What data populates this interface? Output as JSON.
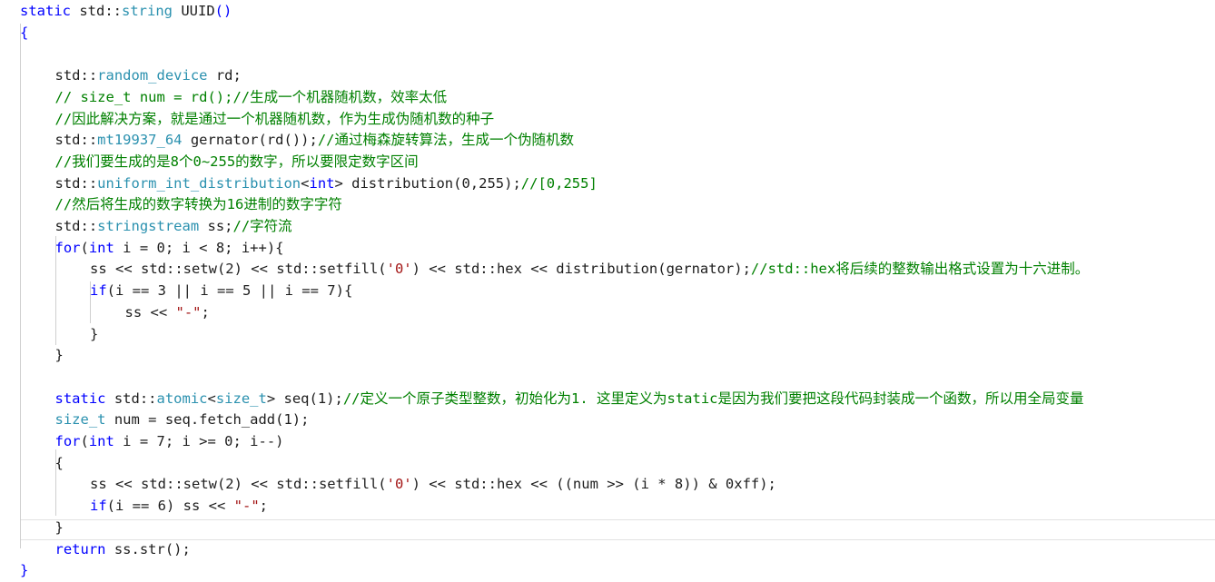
{
  "editor": {
    "accent_colors": {
      "keyword": "#0000ff",
      "type": "#2b91af",
      "comment": "#008000",
      "string": "#a31515",
      "text": "#1e1e1e"
    },
    "lines": [
      {
        "indent": 0,
        "tokens": [
          [
            "kw",
            "static"
          ],
          [
            "nm",
            " std::"
          ],
          [
            "ty",
            "string"
          ],
          [
            "nm",
            " UUID"
          ],
          [
            "kw",
            "()"
          ]
        ]
      },
      {
        "indent": 0,
        "tokens": [
          [
            "kw",
            "{"
          ]
        ]
      },
      {
        "indent": 0,
        "tokens": []
      },
      {
        "indent": 1,
        "tokens": [
          [
            "nm",
            "std::"
          ],
          [
            "ty",
            "random_device"
          ],
          [
            "nm",
            " rd;"
          ]
        ]
      },
      {
        "indent": 1,
        "tokens": [
          [
            "cm",
            "// size_t num = rd();//生成一个机器随机数，效率太低"
          ]
        ]
      },
      {
        "indent": 1,
        "tokens": [
          [
            "cm",
            "//因此解决方案，就是通过一个机器随机数，作为生成伪随机数的种子"
          ]
        ]
      },
      {
        "indent": 1,
        "tokens": [
          [
            "nm",
            "std::"
          ],
          [
            "ty",
            "mt19937_64"
          ],
          [
            "nm",
            " gernator(rd());"
          ],
          [
            "cm",
            "//通过梅森旋转算法，生成一个伪随机数"
          ]
        ]
      },
      {
        "indent": 1,
        "tokens": [
          [
            "cm",
            "//我们要生成的是8个0~255的数字，所以要限定数字区间"
          ]
        ]
      },
      {
        "indent": 1,
        "tokens": [
          [
            "nm",
            "std::"
          ],
          [
            "ty",
            "uniform_int_distribution"
          ],
          [
            "nm",
            "<"
          ],
          [
            "kw",
            "int"
          ],
          [
            "nm",
            "> distribution(0,255);"
          ],
          [
            "cm",
            "//[0,255]"
          ]
        ]
      },
      {
        "indent": 1,
        "tokens": [
          [
            "cm",
            "//然后将生成的数字转换为16进制的数字字符"
          ]
        ]
      },
      {
        "indent": 1,
        "tokens": [
          [
            "nm",
            "std::"
          ],
          [
            "ty",
            "stringstream"
          ],
          [
            "nm",
            " ss;"
          ],
          [
            "cm",
            "//字符流"
          ]
        ]
      },
      {
        "indent": 1,
        "tokens": [
          [
            "kw",
            "for"
          ],
          [
            "nm",
            "("
          ],
          [
            "kw",
            "int"
          ],
          [
            "nm",
            " i = 0; i < 8; i++){"
          ]
        ]
      },
      {
        "indent": 2,
        "tokens": [
          [
            "nm",
            "ss << std::setw(2) << std::setfill("
          ],
          [
            "st",
            "'0'"
          ],
          [
            "nm",
            ") << std::hex << distribution(gernator);"
          ],
          [
            "cm",
            "//std::hex将后续的整数输出格式设置为十六进制。"
          ]
        ]
      },
      {
        "indent": 2,
        "tokens": [
          [
            "kw",
            "if"
          ],
          [
            "nm",
            "(i == 3 || i == 5 || i == 7){"
          ]
        ]
      },
      {
        "indent": 3,
        "tokens": [
          [
            "nm",
            "ss << "
          ],
          [
            "st",
            "\"-\""
          ],
          [
            "nm",
            ";"
          ]
        ]
      },
      {
        "indent": 2,
        "tokens": [
          [
            "nm",
            "}"
          ]
        ]
      },
      {
        "indent": 1,
        "tokens": [
          [
            "nm",
            "}"
          ]
        ]
      },
      {
        "indent": 0,
        "tokens": []
      },
      {
        "indent": 1,
        "tokens": [
          [
            "kw",
            "static"
          ],
          [
            "nm",
            " std::"
          ],
          [
            "ty",
            "atomic"
          ],
          [
            "nm",
            "<"
          ],
          [
            "ty",
            "size_t"
          ],
          [
            "nm",
            "> seq(1);"
          ],
          [
            "cm",
            "//定义一个原子类型整数，初始化为1. 这里定义为static是因为我们要把这段代码封装成一个函数，所以用全局变量"
          ]
        ]
      },
      {
        "indent": 1,
        "tokens": [
          [
            "ty",
            "size_t"
          ],
          [
            "nm",
            " num = seq.fetch_add(1);"
          ]
        ]
      },
      {
        "indent": 1,
        "tokens": [
          [
            "kw",
            "for"
          ],
          [
            "nm",
            "("
          ],
          [
            "kw",
            "int"
          ],
          [
            "nm",
            " i = 7; i >= 0; i--)"
          ]
        ]
      },
      {
        "indent": 1,
        "tokens": [
          [
            "nm",
            "{"
          ]
        ]
      },
      {
        "indent": 2,
        "tokens": [
          [
            "nm",
            "ss << std::setw(2) << std::setfill("
          ],
          [
            "st",
            "'0'"
          ],
          [
            "nm",
            ") << std::hex << ((num >> (i * 8)) & 0xff);"
          ]
        ]
      },
      {
        "indent": 2,
        "tokens": [
          [
            "kw",
            "if"
          ],
          [
            "nm",
            "(i == 6) ss << "
          ],
          [
            "st",
            "\"-\""
          ],
          [
            "nm",
            ";"
          ]
        ]
      },
      {
        "indent": 1,
        "tokens": [
          [
            "nm",
            "}"
          ]
        ]
      },
      {
        "indent": 1,
        "tokens": [
          [
            "kw",
            "return"
          ],
          [
            "nm",
            " ss.str();"
          ]
        ]
      },
      {
        "indent": 0,
        "tokens": [
          [
            "kw",
            "}"
          ]
        ]
      }
    ]
  }
}
